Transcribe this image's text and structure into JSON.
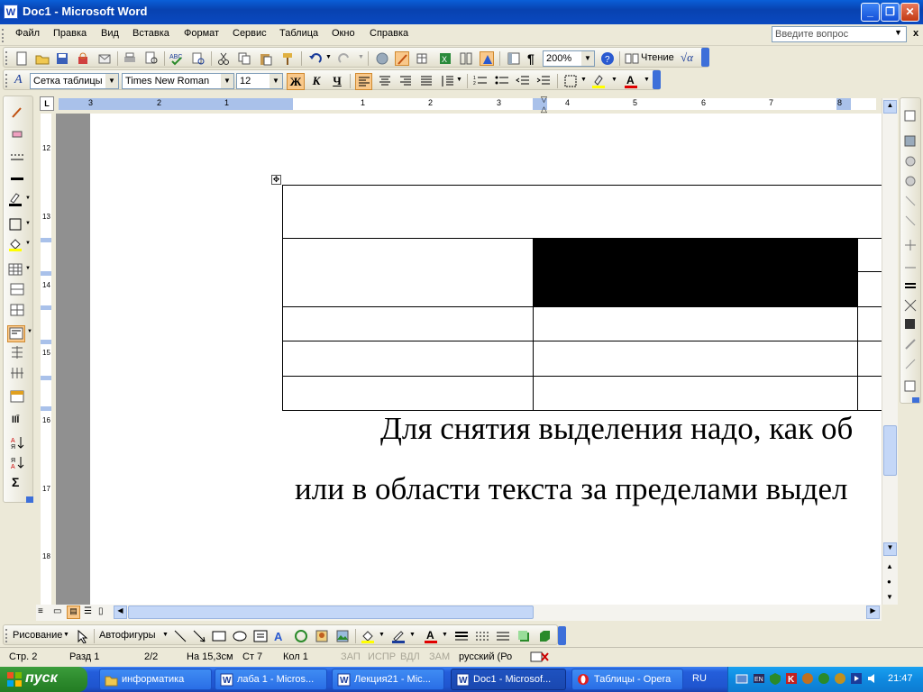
{
  "window": {
    "title": "Doc1 - Microsoft Word",
    "app_icon_letter": "W"
  },
  "menu": {
    "items": [
      "Файл",
      "Правка",
      "Вид",
      "Вставка",
      "Формат",
      "Сервис",
      "Таблица",
      "Окно",
      "Справка"
    ],
    "ask_placeholder": "Введите вопрос"
  },
  "toolbar_standard": {
    "zoom": "200%",
    "read_label": "Чтение",
    "paragraph_mark": "¶"
  },
  "toolbar_formatting": {
    "style": "Сетка таблицы",
    "font": "Times New Roman",
    "size": "12",
    "bold": "Ж",
    "italic": "К",
    "underline": "Ч"
  },
  "ruler": {
    "h_labels": [
      "3",
      "2",
      "1",
      "1",
      "2",
      "3",
      "4",
      "5",
      "6",
      "7",
      "8"
    ],
    "v_labels": [
      "12",
      "13",
      "14",
      "15",
      "16",
      "17",
      "18"
    ]
  },
  "document": {
    "line1": "Для снятия выделения надо, как об",
    "line2": "или в области текста за пределами выдел"
  },
  "drawing_toolbar": {
    "draw_label": "Рисование",
    "autoshapes_label": "Автофигуры"
  },
  "status": {
    "page": "Стр. 2",
    "section": "Разд 1",
    "pages": "2/2",
    "at": "На 15,3см",
    "line": "Ст 7",
    "col": "Кол 1",
    "rec": "ЗАП",
    "trk": "ИСПР",
    "ext": "ВДЛ",
    "ovr": "ЗАМ",
    "language": "русский (Ро"
  },
  "taskbar": {
    "start_label": "пуск",
    "tasks": [
      {
        "label": "информатика"
      },
      {
        "label": "лаба 1 - Micros..."
      },
      {
        "label": "Лекция21 - Mic..."
      },
      {
        "label": "Doc1 - Microsof..."
      },
      {
        "label": "Таблицы - Opera"
      }
    ],
    "lang": "RU",
    "clock": "21:47"
  },
  "colors": {
    "title_blue": "#0842b0",
    "start_green": "#2e8b2e",
    "selection_black": "#000000",
    "active_btn": "#f9c88a"
  }
}
